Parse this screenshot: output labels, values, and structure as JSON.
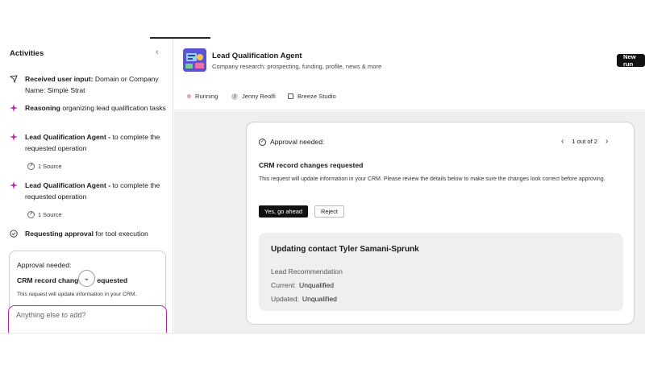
{
  "sidebar": {
    "title": "Activities",
    "collapse_icon": "chevron-left-icon",
    "activities": [
      {
        "icon": "send-icon",
        "bold": "Received user input:",
        "text": " Domain or Company Name: Simple Strat"
      },
      {
        "icon": "sparkle-icon",
        "bold": "Reasoning",
        "text": " organizing lead qualification tasks"
      },
      {
        "icon": "sparkle-icon",
        "bold": "Lead Qualification Agent -",
        "text": " to complete the requested operation",
        "source": "1 Source"
      },
      {
        "icon": "sparkle-icon",
        "bold": "Lead Qualification Agent -",
        "text": " to complete the requested operation",
        "source": "1 Source"
      },
      {
        "icon": "check-circle-icon",
        "bold": "Requesting approval",
        "text": " for tool execution"
      }
    ],
    "approval_card": {
      "title": "Approval needed:",
      "subtitle_start": "CRM record chang",
      "subtitle_end": "equested",
      "body": "This request will update information in your CRM."
    },
    "input_placeholder": "Anything else to add?"
  },
  "header": {
    "agent_title": "Lead Qualification Agent",
    "agent_subtitle": "Company research: prospecting, funding, profile, news & more",
    "new_run_label": "New run",
    "status": "Running",
    "user": "Jenny Reolfi",
    "studio": "Breeze Studio"
  },
  "approval": {
    "header": "Approval needed:",
    "pager": "1 out of 2",
    "title": "CRM record changes requested",
    "description": "This request will update information in your CRM. Please review the details below to make sure the changes look correct before approving.",
    "confirm_label": "Yes, go ahead",
    "reject_label": "Reject",
    "detail": {
      "title": "Updating contact Tyler Samani-Sprunk",
      "field_label": "Lead Recommendation",
      "current_label": "Current:",
      "current_value": "Unqualified",
      "updated_label": "Updated:",
      "updated_value": "Unqualified"
    }
  },
  "colors": {
    "accent": "#c21a9c",
    "primary_button": "#111111",
    "agent_logo": "#5a4fcf",
    "content_bg": "#efefef"
  }
}
